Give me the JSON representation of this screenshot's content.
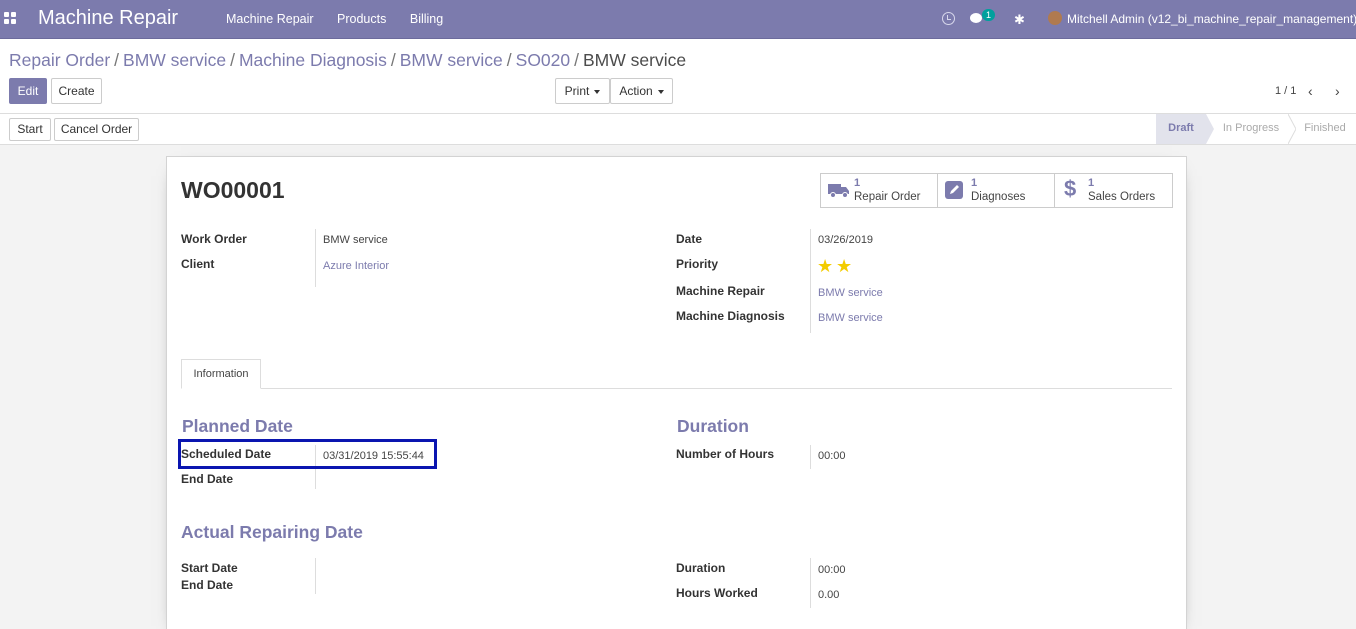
{
  "navbar": {
    "app_name": "Machine Repair",
    "menu": [
      "Machine Repair",
      "Products",
      "Billing"
    ],
    "chat_count": "1",
    "user": "Mitchell Admin (v12_bi_machine_repair_management)",
    "bg_color": "#7c7bad"
  },
  "breadcrumb": {
    "items": [
      "Repair Order",
      "BMW service",
      "Machine Diagnosis",
      "BMW service",
      "SO020"
    ],
    "active": "BMW service",
    "separator": "/"
  },
  "toolbar": {
    "edit_label": "Edit",
    "create_label": "Create",
    "print_label": "Print",
    "action_label": "Action",
    "pager": "1 / 1"
  },
  "statusbar": {
    "start_label": "Start",
    "cancel_label": "Cancel Order",
    "steps": [
      "Draft",
      "In Progress",
      "Finished"
    ],
    "active_step": "Draft"
  },
  "record": {
    "title": "WO00001",
    "smart_buttons": [
      {
        "count": "1",
        "label": "Repair Order",
        "icon": "truck-icon"
      },
      {
        "count": "1",
        "label": "Diagnoses",
        "icon": "pencil-icon"
      },
      {
        "count": "1",
        "label": "Sales Orders",
        "icon": "dollar-icon"
      }
    ],
    "left_fields": [
      {
        "label": "Work Order",
        "value": "BMW service"
      },
      {
        "label": "Client",
        "value": "Azure Interior"
      }
    ],
    "right_fields": [
      {
        "label": "Date",
        "value": "03/26/2019"
      },
      {
        "label": "Priority",
        "value": ""
      },
      {
        "label": "Machine Repair",
        "value": "BMW service"
      },
      {
        "label": "Machine Diagnosis",
        "value": "BMW service"
      }
    ],
    "priority_stars": 2,
    "tab": "Information",
    "planned": {
      "title": "Planned Date",
      "scheduled_label": "Scheduled Date",
      "scheduled_value": "03/31/2019 15:55:44",
      "end_label": "End Date",
      "end_value": ""
    },
    "duration": {
      "title": "Duration",
      "hours_label": "Number of Hours",
      "hours_value": "00:00"
    },
    "actual": {
      "title": "Actual Repairing Date",
      "start_label": "Start Date",
      "end_label": "End Date",
      "duration_label": "Duration",
      "duration_value": "00:00",
      "worked_label": "Hours Worked",
      "worked_value": "0.00"
    }
  }
}
